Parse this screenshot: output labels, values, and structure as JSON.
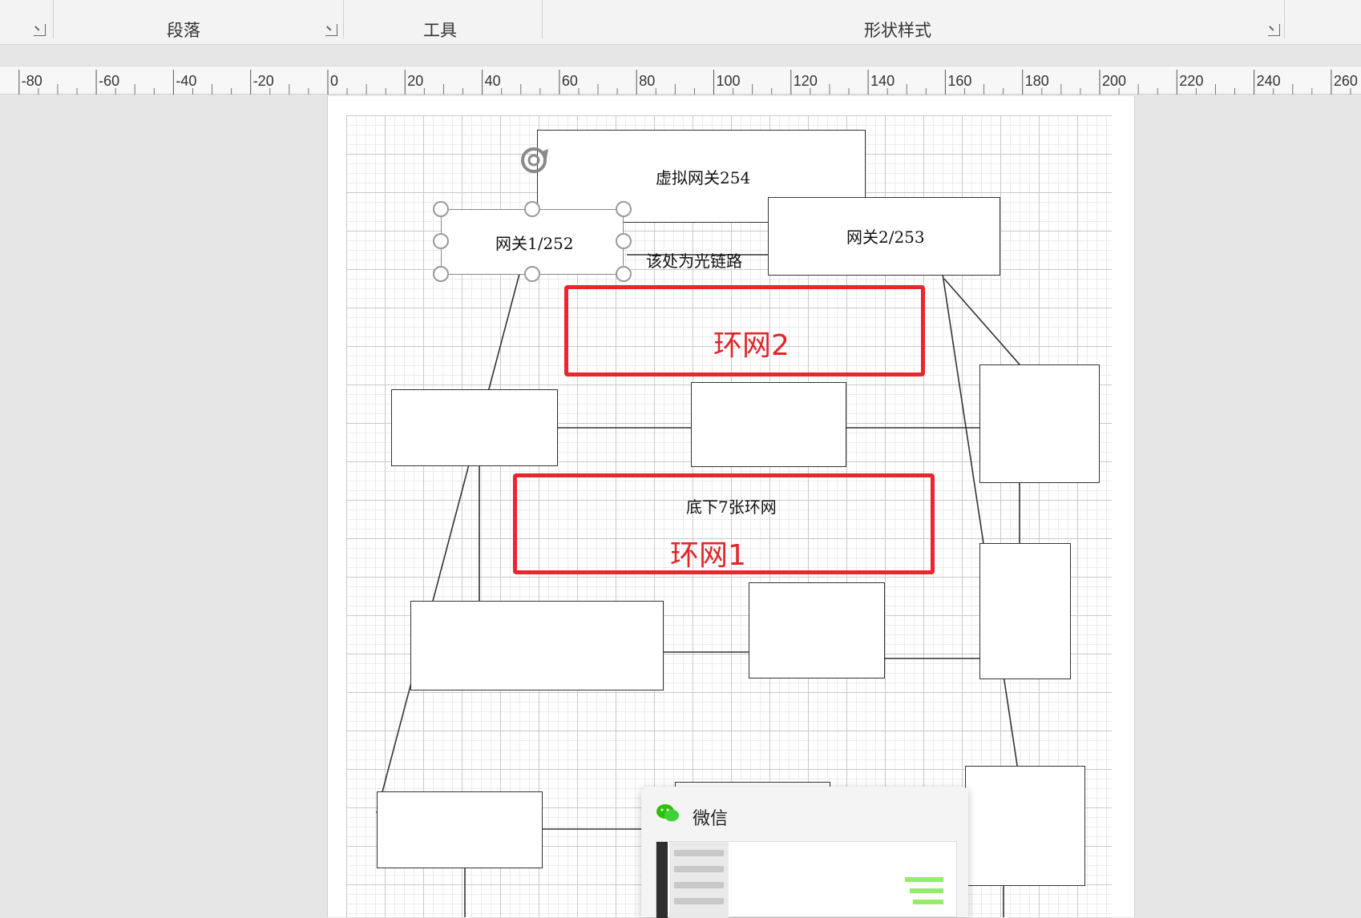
{
  "ribbon": {
    "groups": [
      {
        "label": "段落"
      },
      {
        "label": "工具"
      },
      {
        "label": "形状样式"
      }
    ]
  },
  "ruler": {
    "ticks": [
      "-80",
      "-60",
      "-40",
      "-20",
      "0",
      "20",
      "40",
      "60",
      "80",
      "100",
      "120",
      "140",
      "160",
      "180",
      "200",
      "220",
      "240",
      "260"
    ]
  },
  "diagram": {
    "virtual_gateway": "虚拟网关254",
    "gateway1": "网关1/252",
    "gateway2": "网关2/253",
    "fiber_note": "该处为光链路",
    "ring2_label": "环网2",
    "ring1_caption": "底下7张环网",
    "ring1_label": "环网1"
  },
  "wechat_popup": {
    "title": "微信",
    "icon": "wechat-icon"
  },
  "colors": {
    "ring_frame": "#e8262b",
    "wechat_green": "#2dc100"
  }
}
